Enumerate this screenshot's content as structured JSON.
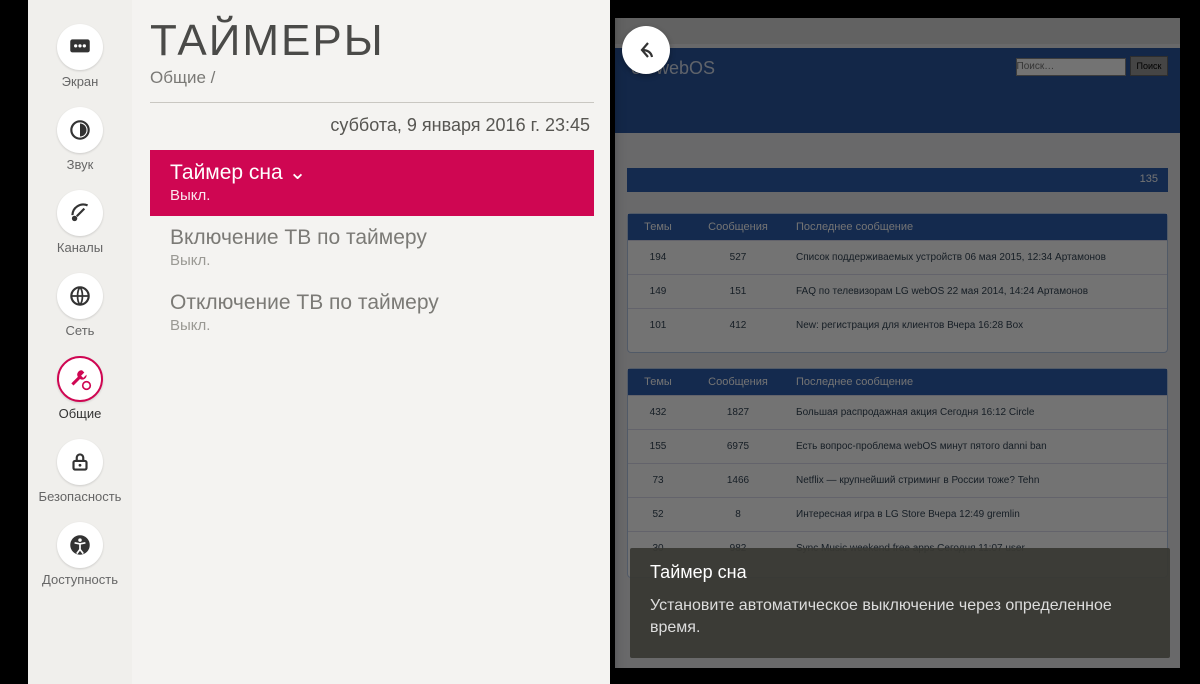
{
  "sidebar": {
    "items": [
      {
        "label": "Экран",
        "icon": "screen"
      },
      {
        "label": "Звук",
        "icon": "sound"
      },
      {
        "label": "Каналы",
        "icon": "channels"
      },
      {
        "label": "Сеть",
        "icon": "network"
      },
      {
        "label": "Общие",
        "icon": "general"
      },
      {
        "label": "Безопасность",
        "icon": "lock"
      },
      {
        "label": "Доступность",
        "icon": "accessibility"
      }
    ],
    "selected_index": 4
  },
  "header": {
    "title": "ТАЙМЕРЫ",
    "breadcrumb": "Общие /",
    "datetime": "суббота, 9 января 2016 г. 23:45"
  },
  "options": [
    {
      "title": "Таймер сна",
      "value": "Выкл.",
      "active": true,
      "has_dropdown": true
    },
    {
      "title": "Включение ТВ по таймеру",
      "value": "Выкл.",
      "active": false
    },
    {
      "title": "Отключение ТВ по таймеру",
      "value": "Выкл.",
      "active": false
    }
  ],
  "tooltip": {
    "title": "Таймер сна",
    "body": "Установите автоматическое выключение через определенное время."
  },
  "background": {
    "site_title": "en webOS",
    "search_placeholder": "Поиск…",
    "search_button": "Поиск",
    "col_topics": "Темы",
    "col_msgs": "Сообщения",
    "col_last": "Последнее сообщение",
    "sec1_top": "135",
    "sec1_rows": [
      {
        "n1": "194",
        "n2": "527",
        "t": "Список поддерживаемых устройств\n06 мая 2015, 12:34 Артамонов"
      },
      {
        "n1": "149",
        "n2": "151",
        "t": "FAQ по телевизорам LG webOS\n22 мая 2014, 14:24 Артамонов"
      },
      {
        "n1": "101",
        "n2": "412",
        "t": "New: регистрация для клиентов\nВчера 16:28 Box"
      }
    ],
    "sec2_rows": [
      {
        "n1": "432",
        "n2": "1827",
        "t": "Большая распродажная акция\nСегодня 16:12 Circle"
      },
      {
        "n1": "155",
        "n2": "6975",
        "t": "Есть вопрос-проблема webOS\nминут пятого danni ban"
      },
      {
        "n1": "73",
        "n2": "1466",
        "t": "Netflix — крупнейший стриминг\nв России тоже? Tehn"
      },
      {
        "n1": "52",
        "n2": "8",
        "t": "Интересная игра в LG Store\nВчера 12:49 gremlin"
      },
      {
        "n1": "30",
        "n2": "982",
        "t": "Sync Music weekend free apps\nСегодня 11:07 user"
      }
    ]
  }
}
